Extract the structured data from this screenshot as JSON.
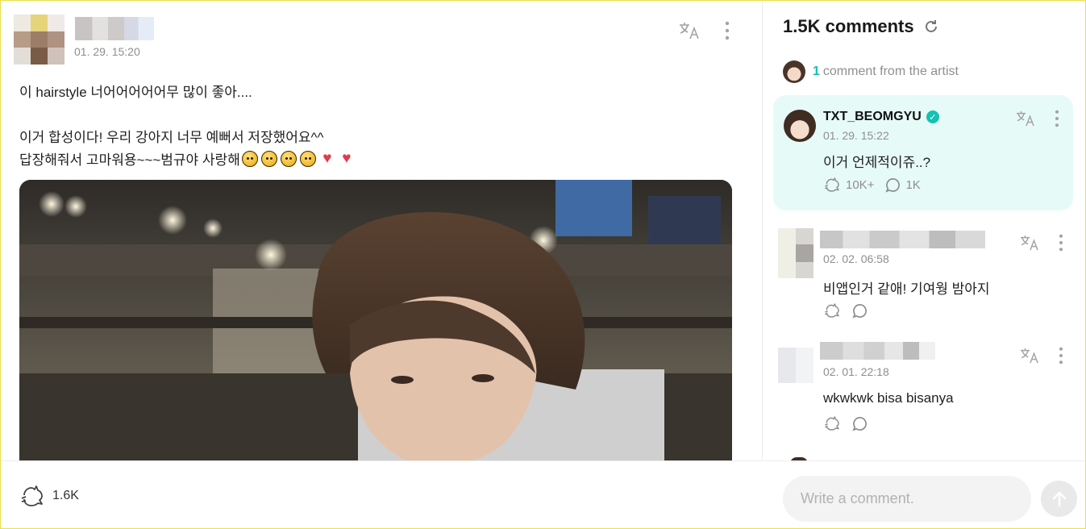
{
  "post": {
    "author_name": "",
    "date": "01. 29. 15:20",
    "lines": [
      "이 hairstyle 너어어어어어무 많이 좋아....",
      "",
      "이거 합성이다! 우리 강아지 너무 예뻐서 저장했어요^^",
      "답장해줘서 고마워용~~~범규야 사랑해"
    ],
    "line_emojis": [
      "pleading-face",
      "pleading-face",
      "crying-face",
      "crying-face",
      "heart-with-arrow",
      "heart-with-arrow"
    ],
    "translate_icon": "translate-icon",
    "more_icon": "more-vertical-icon",
    "like_icon": "paw-like-icon",
    "like_count": "1.6K"
  },
  "comments_panel": {
    "title": "1.5K comments",
    "refresh_icon": "refresh-icon",
    "artist_note_count": "1",
    "artist_note_text": "comment from the artist",
    "artist_comment": {
      "name": "TXT_BEOMGYU",
      "date": "01. 29. 15:22",
      "text": "이거 언제적이쥬..?",
      "likes": "10K+",
      "replies": "1K",
      "bg_color": "#e6fbf7",
      "accent": "#13c2b3"
    },
    "comments": [
      {
        "date": "02. 02. 06:58",
        "text": "비앱인거 같애! 기여웡 밤아지"
      },
      {
        "date": "02. 01. 22:18",
        "text": "wkwkwk bisa bisanya"
      }
    ],
    "input_placeholder": "Write a comment.",
    "send_icon": "arrow-up-icon"
  }
}
